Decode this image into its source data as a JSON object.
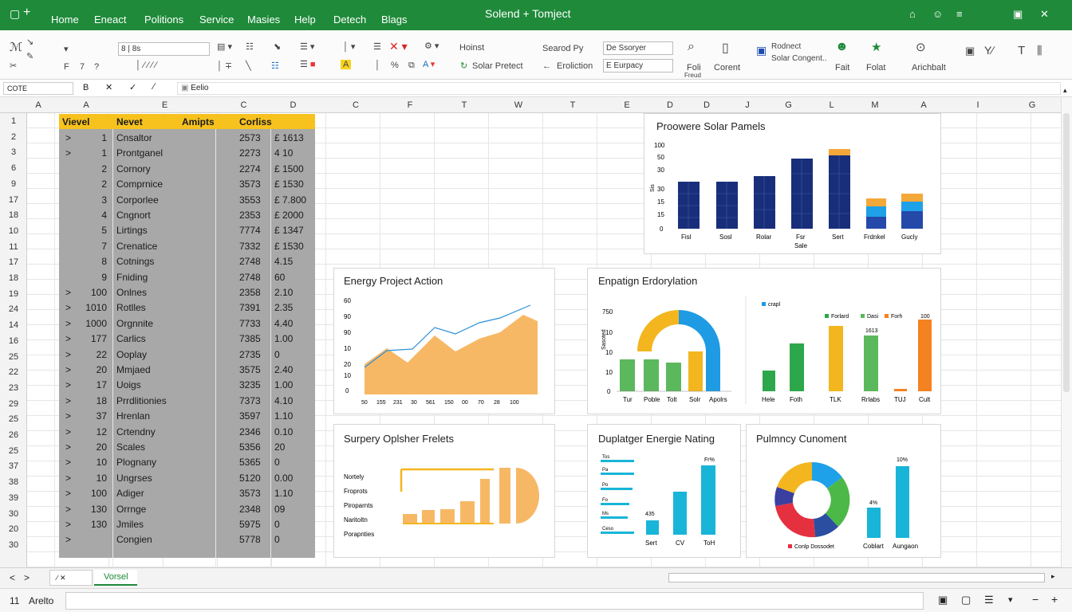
{
  "titlebar": {
    "app_icon": "document-icon",
    "tabs": [
      "Home",
      "Eneact",
      "Politions",
      "Service",
      "Masies",
      "Help",
      "Detech",
      "Blags"
    ],
    "title": "Solend + Tomject",
    "window_icons": [
      "home-icon",
      "smiley-icon",
      "menu-icon",
      "restore-icon",
      "close-icon"
    ]
  },
  "ribbon": {
    "font_box": "8 | 8s",
    "font_name_right": "Hoinst",
    "font_sub": "Solar Pretect",
    "search_label": "Searod Py",
    "search_label2": "Eroliction",
    "dropdown1": "De Ssoryer",
    "dropdown2": "E Eurpacy",
    "btn_foil": "Foli",
    "btn_foil_sub": "Freud",
    "btn_corrent": "Corent",
    "btn_product_title": "Rodnect",
    "btn_product_sub": "Solar Congent..",
    "btn_fait": "Fait",
    "btn_folat": "Folat",
    "btn_archbalt": "Arichbalt",
    "row2_labels": [
      "F",
      "7",
      "?"
    ],
    "percent_mark": "%"
  },
  "formulabar": {
    "namebox": "COTE",
    "fx_label": "B",
    "content": "Eelio"
  },
  "grid": {
    "column_headers": [
      "A",
      "A",
      "E",
      "C",
      "D",
      "C",
      "F",
      "T",
      "W",
      "T",
      "E",
      "D",
      "D",
      "J",
      "G",
      "L",
      "M",
      "A",
      "I",
      "G"
    ],
    "row_numbers": [
      "1",
      "2",
      "3",
      "6",
      "9",
      "17",
      "18",
      "10",
      "11",
      "17",
      "18",
      "19",
      "24",
      "14",
      "16",
      "25",
      "22",
      "23",
      "29",
      "25",
      "26",
      "25",
      "37",
      "38",
      "39",
      "30",
      "20",
      "30"
    ]
  },
  "table": {
    "headers": [
      "Vievel",
      "Nevet",
      "Amipts",
      "Corliss",
      ""
    ],
    "rows": [
      {
        "a": ">",
        "b": "1",
        "c": "Cnsaltor",
        "d": "2573",
        "e": "£ 1613"
      },
      {
        "a": ">",
        "b": "1",
        "c": "Prontganel",
        "d": "2273",
        "e": "4 10"
      },
      {
        "a": "",
        "b": "2",
        "c": "Cornory",
        "d": "2274",
        "e": "£ 1500"
      },
      {
        "a": "",
        "b": "2",
        "c": "Comprnice",
        "d": "3573",
        "e": "£ 1530"
      },
      {
        "a": "",
        "b": "3",
        "c": "Corporlee",
        "d": "3553",
        "e": "£ 7.800"
      },
      {
        "a": "",
        "b": "4",
        "c": "Cngnort",
        "d": "2353",
        "e": "£ 2000"
      },
      {
        "a": "",
        "b": "5",
        "c": "Lirtings",
        "d": "7774",
        "e": "£ 1347"
      },
      {
        "a": "",
        "b": "7",
        "c": "Crenatice",
        "d": "7332",
        "e": "£ 1530"
      },
      {
        "a": "",
        "b": "8",
        "c": "Cotnings",
        "d": "2748",
        "e": "4.15"
      },
      {
        "a": "",
        "b": "9",
        "c": "Fniding",
        "d": "2748",
        "e": "60"
      },
      {
        "a": ">",
        "b": "100",
        "c": "Onlnes",
        "d": "2358",
        "e": "2.10"
      },
      {
        "a": ">",
        "b": "1010",
        "c": "Rotlles",
        "d": "7391",
        "e": "2.35"
      },
      {
        "a": ">",
        "b": "1000",
        "c": "Orgnnite",
        "d": "7733",
        "e": "4.40"
      },
      {
        "a": ">",
        "b": "177",
        "c": "Carlics",
        "d": "7385",
        "e": "1.00"
      },
      {
        "a": ">",
        "b": "22",
        "c": "Ooplay",
        "d": "2735",
        "e": "0"
      },
      {
        "a": ">",
        "b": "20",
        "c": "Mmjaed",
        "d": "3575",
        "e": "2.40"
      },
      {
        "a": ">",
        "b": "17",
        "c": "Uoigs",
        "d": "3235",
        "e": "1.00"
      },
      {
        "a": ">",
        "b": "18",
        "c": "Prrdlitionies",
        "d": "7373",
        "e": "4.10"
      },
      {
        "a": ">",
        "b": "37",
        "c": "Hrenlan",
        "d": "3597",
        "e": "1.10"
      },
      {
        "a": ">",
        "b": "12",
        "c": "Crtendny",
        "d": "2346",
        "e": "0.10"
      },
      {
        "a": ">",
        "b": "20",
        "c": "Scales",
        "d": "5356",
        "e": "20"
      },
      {
        "a": ">",
        "b": "10",
        "c": "Plognany",
        "d": "5365",
        "e": "0"
      },
      {
        "a": ">",
        "b": "10",
        "c": "Ungrses",
        "d": "5120",
        "e": "0.00"
      },
      {
        "a": ">",
        "b": "100",
        "c": "Adiger",
        "d": "3573",
        "e": "1.10"
      },
      {
        "a": ">",
        "b": "130",
        "c": "Orrnge",
        "d": "2348",
        "e": "09"
      },
      {
        "a": ">",
        "b": "130",
        "c": "Jmiles",
        "d": "5975",
        "e": "0"
      },
      {
        "a": ">",
        "b": "",
        "c": "Congien",
        "d": "5778",
        "e": "0"
      }
    ]
  },
  "charts": {
    "solar_panels": {
      "title": "Proowere Solar Pamels",
      "yticks": [
        "100",
        "50",
        "30",
        "30",
        "15",
        "15",
        "0"
      ],
      "ylabel": "Sis",
      "categories": [
        "Fisl",
        "Sosl",
        "Rolar",
        "Fsr",
        "Sert",
        "Frdnkel",
        "Gucly"
      ],
      "sublabel": "Sale"
    },
    "energy_action": {
      "title": "Energy Project Action",
      "yticks": [
        "60",
        "90",
        "90",
        "10",
        "20",
        "10",
        "0"
      ],
      "xticks": [
        "50",
        "155",
        "231",
        "30",
        "561",
        "150",
        "00",
        "70",
        "28",
        "100"
      ]
    },
    "engagement": {
      "title": "Enpatign Erdorylation",
      "yticks": [
        "750",
        "10",
        "10",
        "10",
        "0"
      ],
      "ylabel": "Sasoted",
      "categories": [
        "Tur",
        "Poble",
        "Tolt",
        "Solr",
        "Apolrs"
      ]
    },
    "engagement_right": {
      "legend_top": "crapl",
      "legend": [
        "Forlard",
        "Dasi",
        "Forh"
      ],
      "labels_top": [
        "1613",
        "100"
      ],
      "categories": [
        "Hele",
        "Foth",
        "TLK",
        "Rrlabs",
        "TUJ",
        "Cult"
      ]
    },
    "survey": {
      "title": "Surpery Oplsher Frelets",
      "labels": [
        "Nortely",
        "Froprots",
        "Piroparnts",
        "Naritoltn",
        "Porapnties"
      ]
    },
    "display": {
      "title": "Duplatger Energie Nating",
      "labels_left": [
        "Tos",
        "Pa",
        "Po",
        "Fo",
        "Ms",
        "Ceso"
      ],
      "top_label": "Fr%",
      "bar_label": "435",
      "categories": [
        "Sert",
        "CV",
        "ToH"
      ]
    },
    "pulmency": {
      "title": "Pulmncy Cunoment",
      "legend": "Conlp Dossodet",
      "top_label": "10%",
      "bar_label": "4%",
      "categories": [
        "Coblart",
        "Aungaon"
      ]
    }
  },
  "sheettabs": {
    "active": "Vorsel",
    "nav": [
      "<",
      ">"
    ]
  },
  "statusbar": {
    "left_num": "11",
    "left_label": "Arelto"
  }
}
